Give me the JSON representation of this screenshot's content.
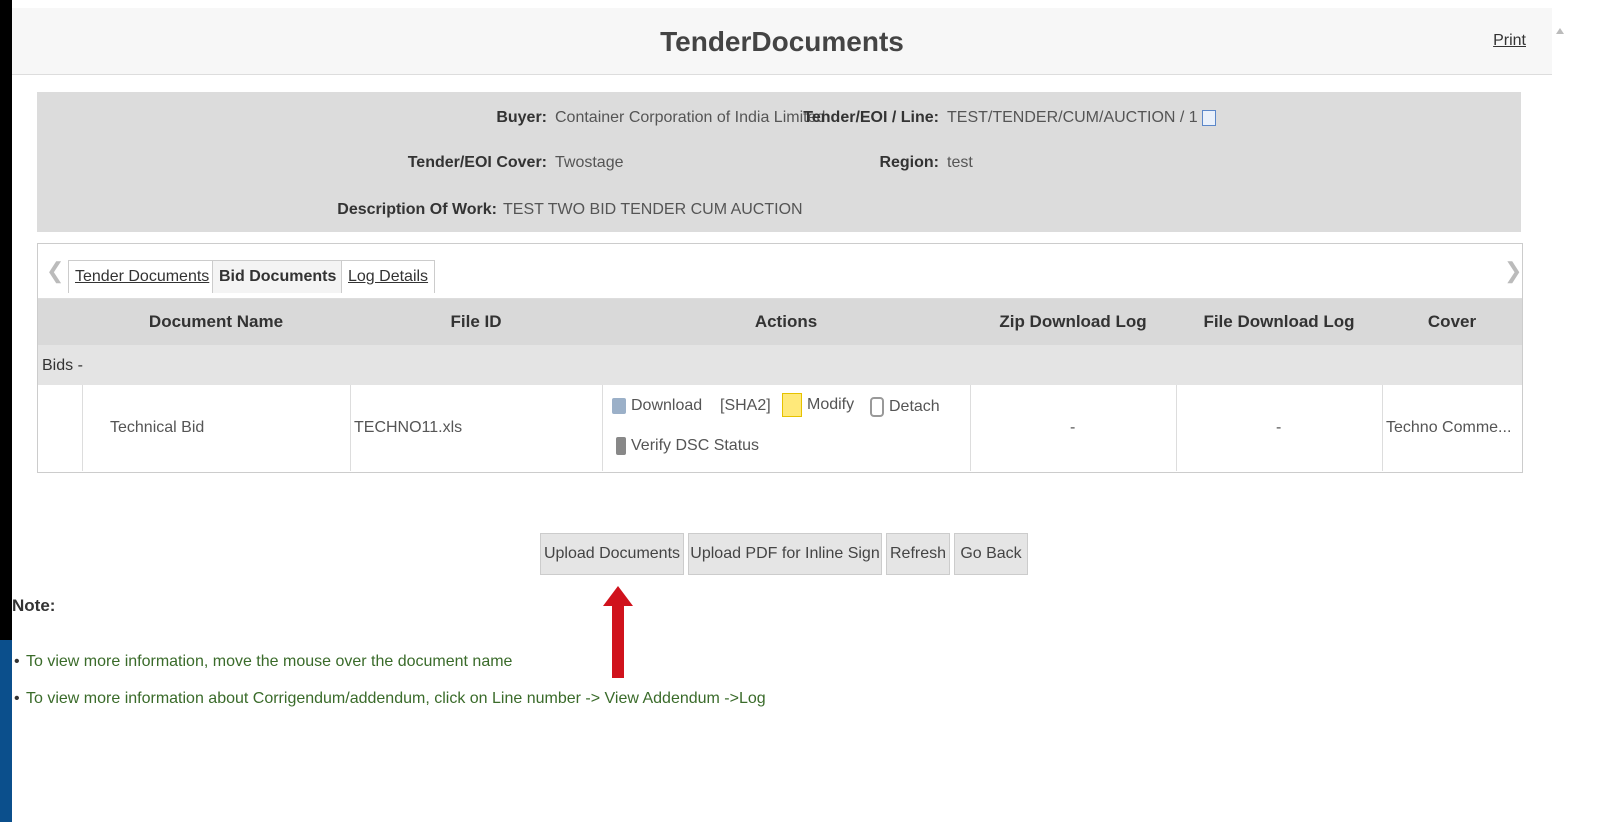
{
  "header": {
    "title": "TenderDocuments",
    "print_label": "Print"
  },
  "info": {
    "buyer_label": "Buyer:",
    "buyer_value": "Container Corporation of India Limited",
    "tender_line_label": "Tender/EOI / Line:",
    "tender_line_value": "TEST/TENDER/CUM/AUCTION / 1",
    "cover_label": "Tender/EOI Cover:",
    "cover_value": "Twostage",
    "region_label": "Region:",
    "region_value": "test",
    "description_label": "Description Of Work:",
    "description_value": "TEST TWO BID TENDER CUM AUCTION"
  },
  "tabs": [
    {
      "label": "Tender Documents"
    },
    {
      "label": "Bid Documents"
    },
    {
      "label": "Log Details"
    }
  ],
  "table": {
    "headers": [
      "Document Name",
      "File ID",
      "Actions",
      "Zip Download Log",
      "File Download Log",
      "Cover"
    ],
    "group_label": "Bids -",
    "row": {
      "document_name": "Technical Bid",
      "file_id": "TECHNO11.xls",
      "actions": {
        "download": "Download",
        "sha": "[SHA2]",
        "modify": "Modify",
        "detach": "Detach",
        "verify": "Verify DSC Status"
      },
      "zip_log": "-",
      "file_log": "-",
      "cover": "Techno Comme..."
    }
  },
  "buttons": {
    "upload_documents": "Upload Documents",
    "upload_pdf": "Upload PDF for Inline Sign",
    "refresh": "Refresh",
    "go_back": "Go Back"
  },
  "notes": {
    "title": "Note:",
    "items": [
      "To view more information, move the mouse over the document name",
      "To view more information about Corrigendum/addendum, click on Line number -> View Addendum ->Log"
    ]
  },
  "annotation": {
    "arrow_color": "#d0121c"
  }
}
